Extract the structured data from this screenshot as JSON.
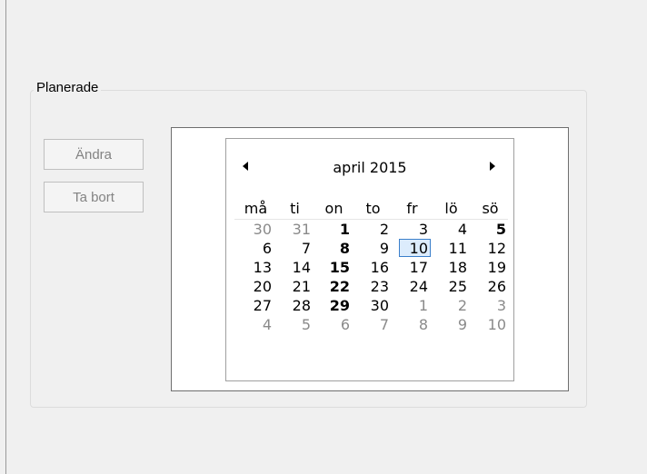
{
  "group": {
    "title": "Planerade"
  },
  "buttons": {
    "edit_label": "Ändra",
    "remove_label": "Ta bort"
  },
  "calendar": {
    "month_title": "april 2015",
    "weekdays": [
      "må",
      "ti",
      "on",
      "to",
      "fr",
      "lö",
      "sö"
    ],
    "today": 10,
    "weeks": [
      [
        {
          "d": "30",
          "m": "prev"
        },
        {
          "d": "31",
          "m": "prev"
        },
        {
          "d": "1",
          "b": true
        },
        {
          "d": "2"
        },
        {
          "d": "3"
        },
        {
          "d": "4"
        },
        {
          "d": "5",
          "b": true
        }
      ],
      [
        {
          "d": "6"
        },
        {
          "d": "7"
        },
        {
          "d": "8",
          "b": true
        },
        {
          "d": "9"
        },
        {
          "d": "10",
          "today": true
        },
        {
          "d": "11"
        },
        {
          "d": "12"
        }
      ],
      [
        {
          "d": "13"
        },
        {
          "d": "14"
        },
        {
          "d": "15",
          "b": true
        },
        {
          "d": "16"
        },
        {
          "d": "17"
        },
        {
          "d": "18"
        },
        {
          "d": "19"
        }
      ],
      [
        {
          "d": "20"
        },
        {
          "d": "21"
        },
        {
          "d": "22",
          "b": true
        },
        {
          "d": "23"
        },
        {
          "d": "24"
        },
        {
          "d": "25"
        },
        {
          "d": "26"
        }
      ],
      [
        {
          "d": "27"
        },
        {
          "d": "28"
        },
        {
          "d": "29",
          "b": true
        },
        {
          "d": "30"
        },
        {
          "d": "1",
          "m": "next"
        },
        {
          "d": "2",
          "m": "next"
        },
        {
          "d": "3",
          "m": "next"
        }
      ],
      [
        {
          "d": "4",
          "m": "next"
        },
        {
          "d": "5",
          "m": "next"
        },
        {
          "d": "6",
          "m": "next"
        },
        {
          "d": "7",
          "m": "next"
        },
        {
          "d": "8",
          "m": "next"
        },
        {
          "d": "9",
          "m": "next"
        },
        {
          "d": "10",
          "m": "next"
        }
      ]
    ]
  },
  "colors": {
    "today_border": "#3b7fcb",
    "today_fill": "#dcecfc",
    "other_month": "#8a8a8a",
    "disabled_text": "#838383"
  },
  "icons": {
    "prev": "triangle-left-icon",
    "next": "triangle-right-icon"
  }
}
